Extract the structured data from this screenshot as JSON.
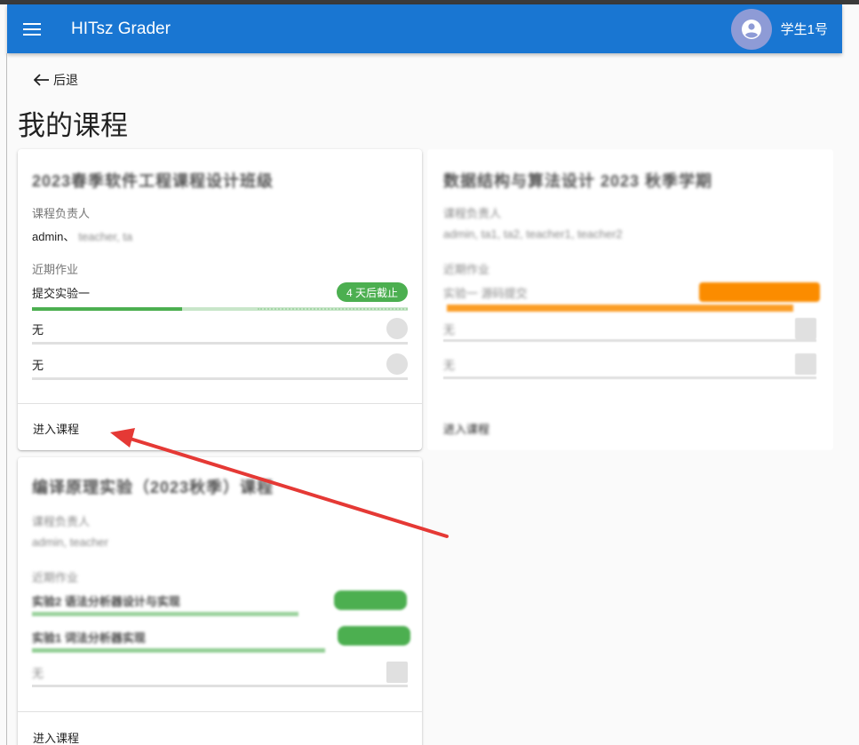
{
  "app": {
    "title": "HITsz Grader",
    "user_name": "学生1号"
  },
  "back_label": "后退",
  "page_title": "我的课程",
  "accent": "#1976d2",
  "courses": [
    {
      "title": "2023春季软件工程课程设计班级",
      "owner_label": "课程负责人",
      "owners": "admin、",
      "owners_blurred": "teacher, ta",
      "recent_label": "近期作业",
      "assignments": [
        {
          "name": "提交实验一",
          "badge": "4 天后截止",
          "progress": 0.55
        },
        {
          "name": "无"
        },
        {
          "name": "无"
        }
      ],
      "enter_label": "进入课程"
    },
    {
      "title": "数据结构与算法设计 2023 秋季学期",
      "owner_label": "课程负责人",
      "owners": "admin, ta1, ta2, teacher1, teacher2",
      "recent_label": "近期作业",
      "assignments": [
        {
          "name": "实验一 源码提交",
          "badge": "已截止"
        },
        {
          "name": "无"
        },
        {
          "name": "无"
        }
      ],
      "enter_label": "进入课程"
    },
    {
      "title": "编译原理实验（2023秋季）课程",
      "owner_label": "课程负责人",
      "owners": "admin, teacher",
      "recent_label": "近期作业",
      "assignments": [
        {
          "name": "实验2 语法分析器设计与实现",
          "badge": "已截止"
        },
        {
          "name": "实验1 词法分析器实现",
          "badge": "已截止"
        },
        {
          "name": "无"
        }
      ],
      "enter_label": "进入课程"
    }
  ]
}
